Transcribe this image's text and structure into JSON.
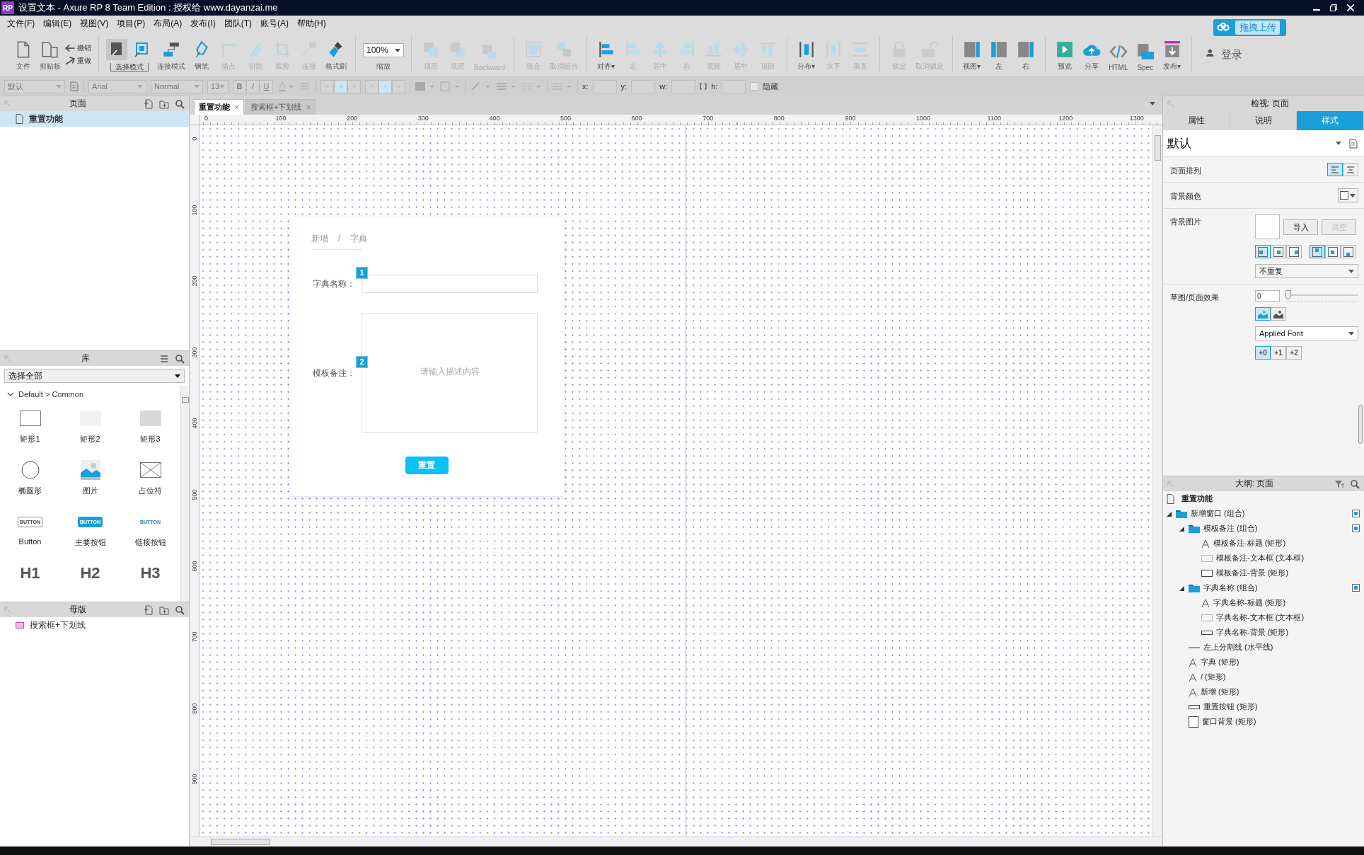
{
  "window": {
    "app_badge": "RP",
    "title": "设置文本 - Axure RP 8 Team Edition : 授权给 www.dayanzai.me"
  },
  "menu": [
    "文件(F)",
    "编辑(E)",
    "视图(V)",
    "项目(P)",
    "布局(A)",
    "发布(I)",
    "团队(T)",
    "账号(A)",
    "帮助(H)"
  ],
  "upload_button": "拖拽上传",
  "toolbar": [
    [
      {
        "kind": "big",
        "label": "文件",
        "disabled": false
      },
      {
        "kind": "big",
        "label": "剪贴板",
        "disabled": false
      },
      {
        "kind": "stack",
        "items": [
          {
            "label": "撤销",
            "disabled": false
          },
          {
            "label": "重做",
            "disabled": false
          }
        ]
      }
    ],
    [
      {
        "kind": "mode",
        "label": "选择模式",
        "options": [
          {
            "selected": true
          },
          {
            "selected": false
          }
        ]
      },
      {
        "kind": "big",
        "label": "连接模式",
        "disabled": false
      },
      {
        "kind": "big",
        "label": "钢笔",
        "disabled": false
      },
      {
        "kind": "big",
        "label": "描点",
        "disabled": true
      },
      {
        "kind": "big",
        "label": "切割",
        "disabled": true
      },
      {
        "kind": "big",
        "label": "裁剪",
        "disabled": true
      },
      {
        "kind": "big",
        "label": "连接",
        "disabled": true
      },
      {
        "kind": "big",
        "label": "格式刷",
        "disabled": false
      }
    ],
    [
      {
        "kind": "zoom",
        "value": "100%",
        "label": "缩放"
      }
    ],
    [
      {
        "kind": "big",
        "label": "顶层",
        "disabled": true
      },
      {
        "kind": "big",
        "label": "底层",
        "disabled": true
      },
      {
        "kind": "big",
        "label": "Backward",
        "disabled": true
      }
    ],
    [
      {
        "kind": "big",
        "label": "组合",
        "disabled": true
      },
      {
        "kind": "big",
        "label": "取消组合",
        "disabled": true
      }
    ],
    [
      {
        "kind": "big",
        "label": "对齐▾",
        "disabled": false
      },
      {
        "kind": "big",
        "label": "左",
        "disabled": true
      },
      {
        "kind": "big",
        "label": "居中",
        "disabled": true
      },
      {
        "kind": "big",
        "label": "右",
        "disabled": true
      },
      {
        "kind": "big",
        "label": "底部",
        "disabled": true
      },
      {
        "kind": "big",
        "label": "居中",
        "disabled": true
      },
      {
        "kind": "big",
        "label": "顶部",
        "disabled": true
      }
    ],
    [
      {
        "kind": "big",
        "label": "分布▾",
        "disabled": false
      },
      {
        "kind": "big",
        "label": "水平",
        "disabled": true
      },
      {
        "kind": "big",
        "label": "垂直",
        "disabled": true
      }
    ],
    [
      {
        "kind": "big",
        "label": "锁定",
        "disabled": true
      },
      {
        "kind": "big",
        "label": "取消锁定",
        "disabled": true
      }
    ],
    [
      {
        "kind": "big",
        "label": "视图▾",
        "disabled": false
      },
      {
        "kind": "big",
        "label": "左",
        "disabled": false
      },
      {
        "kind": "big",
        "label": "右",
        "disabled": false
      }
    ],
    [
      {
        "kind": "big",
        "label": "预览",
        "disabled": false
      },
      {
        "kind": "big",
        "label": "分享",
        "disabled": false
      },
      {
        "kind": "big",
        "label": "HTML",
        "disabled": false
      },
      {
        "kind": "big",
        "label": "Spec",
        "disabled": false
      },
      {
        "kind": "big",
        "label": "发布▾",
        "disabled": false
      }
    ],
    [
      {
        "kind": "login",
        "label": "登录",
        "disabled": false
      }
    ]
  ],
  "format_bar": {
    "style": "默认",
    "font": "Arial",
    "weight": "Normal",
    "size": "13",
    "bold": "B",
    "italic": "I",
    "underline": "U",
    "align": [
      {
        "selected": false
      },
      {
        "selected": true
      },
      {
        "selected": false
      }
    ],
    "valign": [
      {
        "selected": false
      },
      {
        "selected": true
      },
      {
        "selected": false
      }
    ],
    "x_label": "x:",
    "y_label": "y:",
    "w_label": "w:",
    "h_label": "h:",
    "hidden_label": "隐藏",
    "hidden": false
  },
  "pages_panel": {
    "title": "页面",
    "items": [
      {
        "label": "重置功能",
        "selected": true
      }
    ]
  },
  "library_panel": {
    "title": "库",
    "filter": "选择全部",
    "group": "Default > Common",
    "widgets": [
      {
        "kind": "rect-outline",
        "label": "矩形1"
      },
      {
        "kind": "rect-light",
        "label": "矩形2"
      },
      {
        "kind": "rect-dark",
        "label": "矩形3"
      },
      {
        "kind": "ellipse",
        "label": "椭圆形"
      },
      {
        "kind": "image",
        "label": "图片"
      },
      {
        "kind": "placeholder",
        "label": "占位符"
      },
      {
        "kind": "button",
        "preview": "BUTTON",
        "label": "Button"
      },
      {
        "kind": "primary-button",
        "preview": "BUTTON",
        "label": "主要按钮"
      },
      {
        "kind": "link-button",
        "preview": "BUTTON",
        "label": "链接按钮"
      },
      {
        "kind": "heading",
        "preview": "H1"
      },
      {
        "kind": "heading",
        "preview": "H2"
      },
      {
        "kind": "heading",
        "preview": "H3"
      }
    ]
  },
  "masters_panel": {
    "title": "母版",
    "items": [
      {
        "label": "搜索框+下划线"
      }
    ]
  },
  "tabs": [
    {
      "label": "重置功能",
      "close": "×",
      "selected": true
    },
    {
      "label": "搜索框+下划线",
      "close": "×",
      "selected": false
    }
  ],
  "ruler": {
    "x_labels": [
      "0",
      "100",
      "200",
      "300",
      "400",
      "500",
      "600",
      "700",
      "800",
      "900",
      "1000",
      "1100",
      "1200",
      "1300"
    ],
    "y_labels": [
      "0",
      "100",
      "200",
      "300",
      "400",
      "500",
      "600",
      "700",
      "800",
      "900"
    ]
  },
  "form": {
    "breadcrumb": [
      "新增",
      "/",
      "字典"
    ],
    "fields": [
      {
        "kind": "input",
        "label": "字典名称：",
        "badge": "1"
      },
      {
        "kind": "textarea",
        "label": "模板备注：",
        "badge": "2",
        "placeholder": "请输入描述内容"
      }
    ],
    "button": "重置"
  },
  "inspector": {
    "title": "检视: 页面",
    "tabs": [
      {
        "label": "属性",
        "selected": false
      },
      {
        "label": "说明",
        "selected": false
      },
      {
        "label": "样式",
        "selected": true
      }
    ],
    "style_name": "默认",
    "page_align": {
      "label": "页面排列",
      "options": [
        {
          "selected": true
        },
        {
          "selected": false
        }
      ]
    },
    "bg_color": {
      "label": "背景颜色",
      "color": "#ffffff"
    },
    "bg_image": {
      "label": "背景图片",
      "import": "导入",
      "clear": "清空",
      "clear_disabled": true,
      "h_align": [
        {
          "selected": true
        },
        {
          "selected": false
        },
        {
          "selected": false
        }
      ],
      "v_align": [
        {
          "selected": true
        },
        {
          "selected": false
        },
        {
          "selected": false
        }
      ],
      "repeat": "不重复"
    },
    "sketch": {
      "label": "草图/页面效果",
      "value": "0",
      "level": 0,
      "color_modes": [
        {
          "selected": true
        },
        {
          "selected": false
        }
      ],
      "font": "Applied Font",
      "line_widths": [
        {
          "label": "+0",
          "selected": true
        },
        {
          "label": "+1",
          "selected": false
        },
        {
          "label": "+2",
          "selected": false
        }
      ]
    }
  },
  "outline": {
    "title": "大纲: 页面",
    "page": "重置功能",
    "items": [
      {
        "kind": "group",
        "label": "新增窗口 (组合)",
        "expanded": true,
        "checked": true,
        "children": [
          {
            "kind": "group",
            "label": "模板备注 (组合)",
            "expanded": true,
            "checked": true,
            "children": [
              {
                "kind": "text",
                "label": "模板备注-标题 (矩形)",
                "checked": false
              },
              {
                "kind": "textbox",
                "label": "模板备注-文本框 (文本框)",
                "checked": false
              },
              {
                "kind": "rect",
                "label": "模板备注-背景 (矩形)",
                "checked": false
              }
            ]
          },
          {
            "kind": "group",
            "label": "字典名称 (组合)",
            "expanded": true,
            "checked": true,
            "children": [
              {
                "kind": "text",
                "label": "字典名称-标题 (矩形)",
                "checked": false
              },
              {
                "kind": "textbox",
                "label": "字典名称-文本框 (文本框)",
                "checked": false
              },
              {
                "kind": "flat",
                "label": "字典名称-背景 (矩形)",
                "checked": false
              }
            ]
          },
          {
            "kind": "line",
            "label": "左上分割线 (水平线)",
            "checked": false
          },
          {
            "kind": "text",
            "label": "字典 (矩形)",
            "checked": false
          },
          {
            "kind": "text",
            "label": "/ (矩形)",
            "checked": false
          },
          {
            "kind": "text",
            "label": "新增 (矩形)",
            "checked": false
          },
          {
            "kind": "flat",
            "label": "重置按钮 (矩形)",
            "checked": false
          },
          {
            "kind": "box",
            "label": "窗口背景 (矩形)",
            "checked": false
          }
        ]
      }
    ]
  }
}
